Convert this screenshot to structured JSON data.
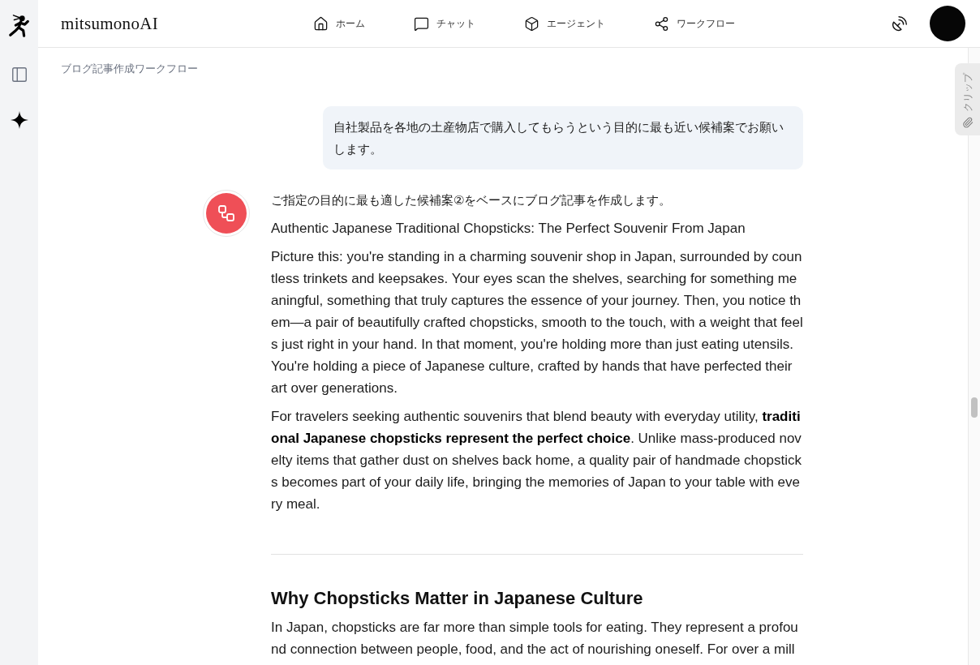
{
  "header": {
    "title": "mitsumonoAI",
    "nav": [
      {
        "label": "ホーム"
      },
      {
        "label": "チャット"
      },
      {
        "label": "エージェント"
      },
      {
        "label": "ワークフロー"
      }
    ]
  },
  "breadcrumb": "ブログ記事作成ワークフロー",
  "clip_tab": {
    "label": "クリップ"
  },
  "messages": [
    {
      "kind": "user",
      "text": "自社製品を各地の土産物店で購入してもらうという目的に最も近い候補案でお願いします。"
    },
    {
      "kind": "assistant",
      "blocks": [
        {
          "kind": "intro",
          "text": "ご指定の目的に最も適した候補案②をベースにブログ記事を作成します。"
        },
        {
          "kind": "title",
          "text": "Authentic Japanese Traditional Chopsticks: The Perfect Souvenir From Japan"
        },
        {
          "kind": "paragraph",
          "text": "Picture this: you're standing in a charming souvenir shop in Japan, surrounded by countless trinkets and keepsakes. Your eyes scan the shelves, searching for something meaningful, something that truly captures the essence of your journey. Then, you notice them—a pair of beautifully crafted chopsticks, smooth to the touch, with a weight that feels just right in your hand. In that moment, you're holding more than just eating utensils. You're holding a piece of Japanese culture, crafted by hands that have perfected their art over generations."
        },
        {
          "kind": "paragraph",
          "text": "For travelers seeking authentic souvenirs that blend beauty with everyday utility, **traditional Japanese chopsticks represent the perfect choice**. Unlike mass-produced novelty items that gather dust on shelves back home, a quality pair of handmade chopsticks becomes part of your daily life, bringing the memories of Japan to your table with every meal."
        },
        {
          "kind": "divider"
        },
        {
          "kind": "heading",
          "text": "Why Chopsticks Matter in Japanese Culture"
        },
        {
          "kind": "paragraph",
          "text": "In Japan, chopsticks are far more than simple tools for eating. They represent a profound connection between people, food, and the act of nourishing oneself. For over a mill"
        }
      ]
    }
  ]
}
